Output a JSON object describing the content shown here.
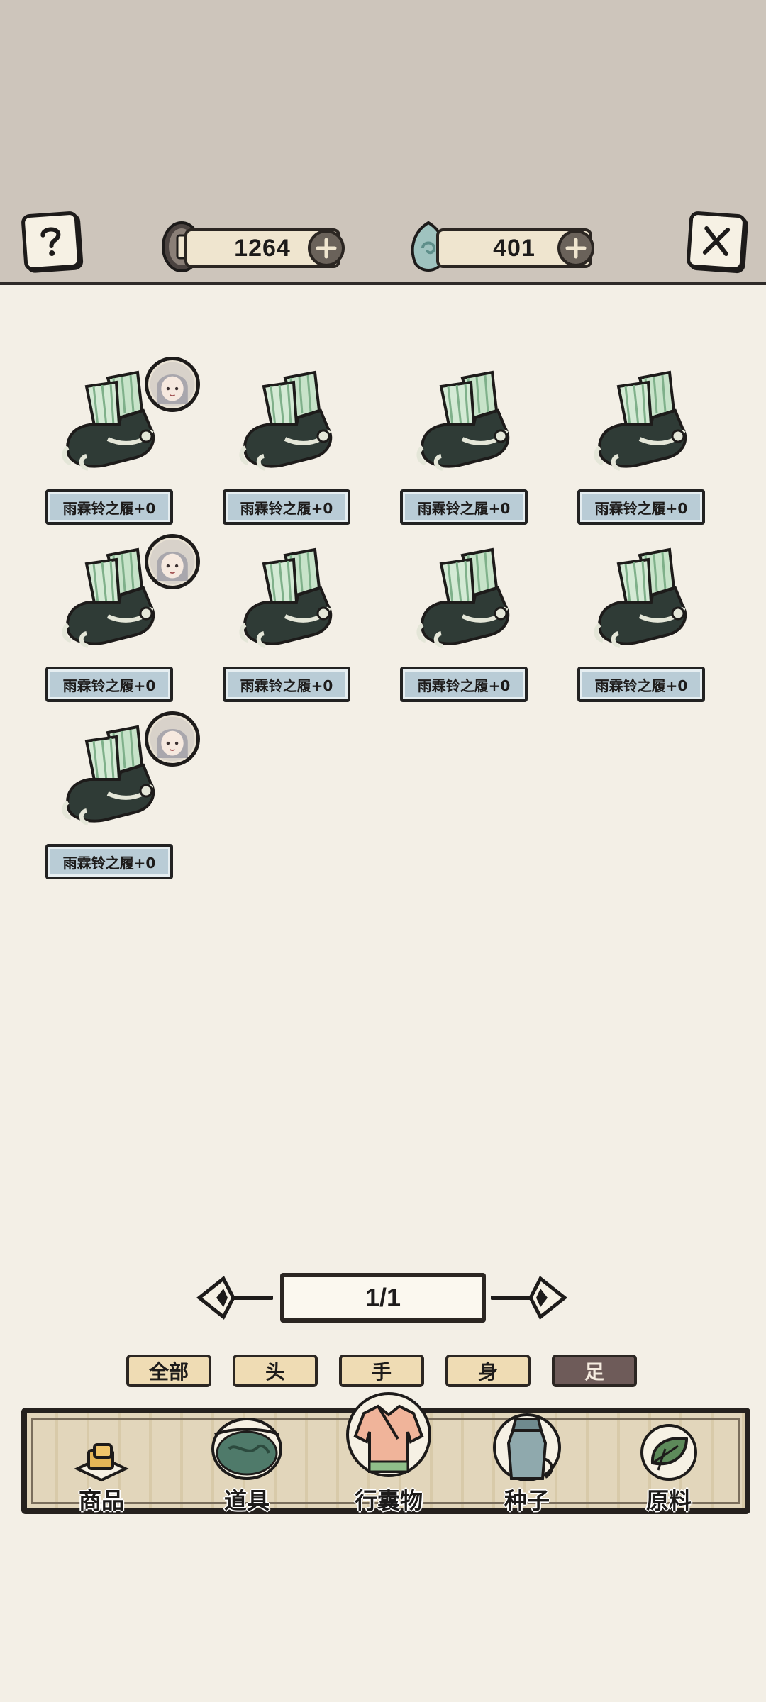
{
  "header": {
    "help_icon": "question-icon",
    "close_icon": "close-x-icon",
    "coin": {
      "icon": "coin-icon",
      "value": "1264"
    },
    "gem": {
      "icon": "jade-gem-icon",
      "value": "401"
    }
  },
  "items": [
    {
      "name": "雨霖铃之履+0",
      "equipped": true
    },
    {
      "name": "雨霖铃之履+0",
      "equipped": false
    },
    {
      "name": "雨霖铃之履+0",
      "equipped": false
    },
    {
      "name": "雨霖铃之履+0",
      "equipped": false
    },
    {
      "name": "雨霖铃之履+0",
      "equipped": true
    },
    {
      "name": "雨霖铃之履+0",
      "equipped": false
    },
    {
      "name": "雨霖铃之履+0",
      "equipped": false
    },
    {
      "name": "雨霖铃之履+0",
      "equipped": false
    },
    {
      "name": "雨霖铃之履+0",
      "equipped": true
    }
  ],
  "pager": {
    "text": "1/1"
  },
  "filters": [
    {
      "label": "全部",
      "active": false
    },
    {
      "label": "头",
      "active": false
    },
    {
      "label": "手",
      "active": false
    },
    {
      "label": "身",
      "active": false
    },
    {
      "label": "足",
      "active": true
    }
  ],
  "nav": [
    {
      "label": "商品",
      "icon": "tofu-goods-icon"
    },
    {
      "label": "道具",
      "icon": "fish-bowl-icon"
    },
    {
      "label": "行囊物",
      "icon": "robe-icon"
    },
    {
      "label": "种子",
      "icon": "seed-jar-icon"
    },
    {
      "label": "原料",
      "icon": "leaf-icon"
    }
  ],
  "colors": {
    "header_bg": "#cdc5bb",
    "page_bg": "#f3efe6",
    "name_plate": "#b9ccd6",
    "filter_bg": "#efdcb4",
    "filter_active_bg": "#6e5b59"
  }
}
